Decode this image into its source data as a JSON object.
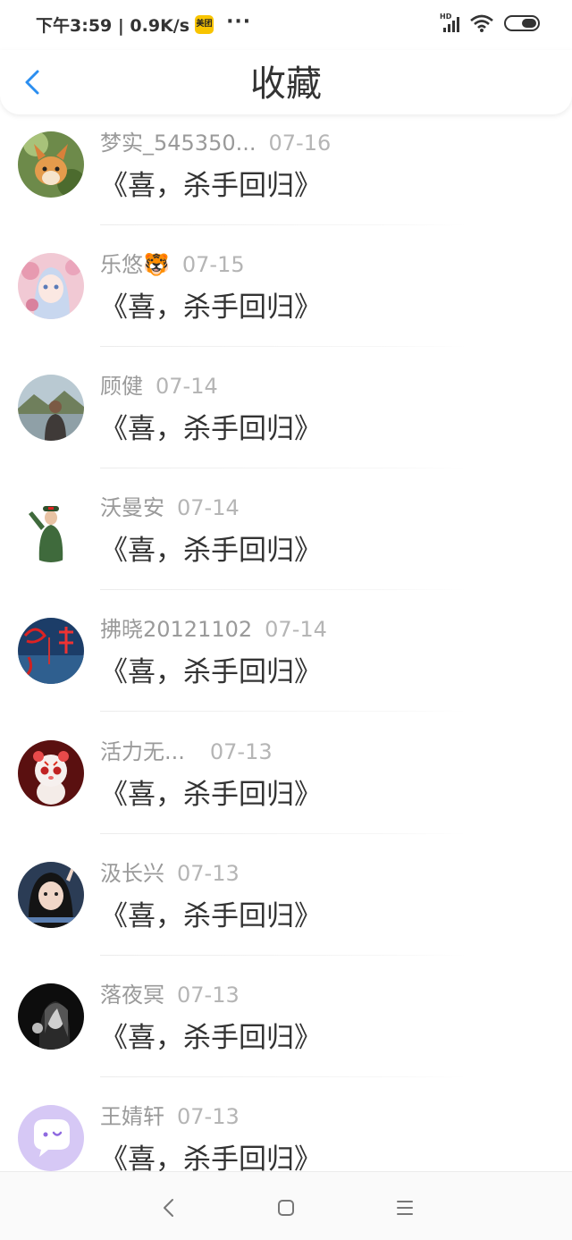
{
  "status_bar": {
    "left_text": "下午3:59 | 0.9K/s",
    "app_badge": "美团",
    "more": "···",
    "signal_label": "HD",
    "icons": [
      "signal-icon",
      "wifi-icon",
      "battery-icon"
    ]
  },
  "header": {
    "back_icon": "chevron-left-icon",
    "title": "收藏"
  },
  "items": [
    {
      "name": "梦实_545350...",
      "date": "07-16",
      "title": "《喜，杀手回归》",
      "avatar": "fox-avatar"
    },
    {
      "name": "乐悠🐯",
      "date": "07-15",
      "title": "《喜，杀手回归》",
      "avatar": "anime-girl-avatar"
    },
    {
      "name": "顾健",
      "date": "07-14",
      "title": "《喜，杀手回归》",
      "avatar": "landscape-person-avatar"
    },
    {
      "name": "沃曼安",
      "date": "07-14",
      "title": "《喜，杀手回归》",
      "avatar": "soldier-avatar"
    },
    {
      "name": "拂晓20121102",
      "date": "07-14",
      "title": "《喜，杀手回归》",
      "avatar": "red-calligraphy-avatar"
    },
    {
      "name": "活力无...",
      "date": "07-13",
      "title": "《喜，杀手回归》",
      "avatar": "tiger-cartoon-avatar"
    },
    {
      "name": "汲长兴",
      "date": "07-13",
      "title": "《喜，杀手回归》",
      "avatar": "girl-selfie-avatar"
    },
    {
      "name": "落夜冥",
      "date": "07-13",
      "title": "《喜，杀手回归》",
      "avatar": "dark-portrait-avatar"
    },
    {
      "name": "王婧轩",
      "date": "07-13",
      "title": "《喜，杀手回归》",
      "avatar": "default-chat-avatar"
    }
  ],
  "nav_bar": {
    "icons": [
      "back-nav-icon",
      "home-nav-icon",
      "menu-nav-icon"
    ]
  },
  "colors": {
    "accent": "#2b8ef0",
    "name_text": "#9a9a9a",
    "date_text": "#b5b5b5",
    "title_text": "#333333",
    "default_avatar_bg": "#d6c8f5"
  }
}
